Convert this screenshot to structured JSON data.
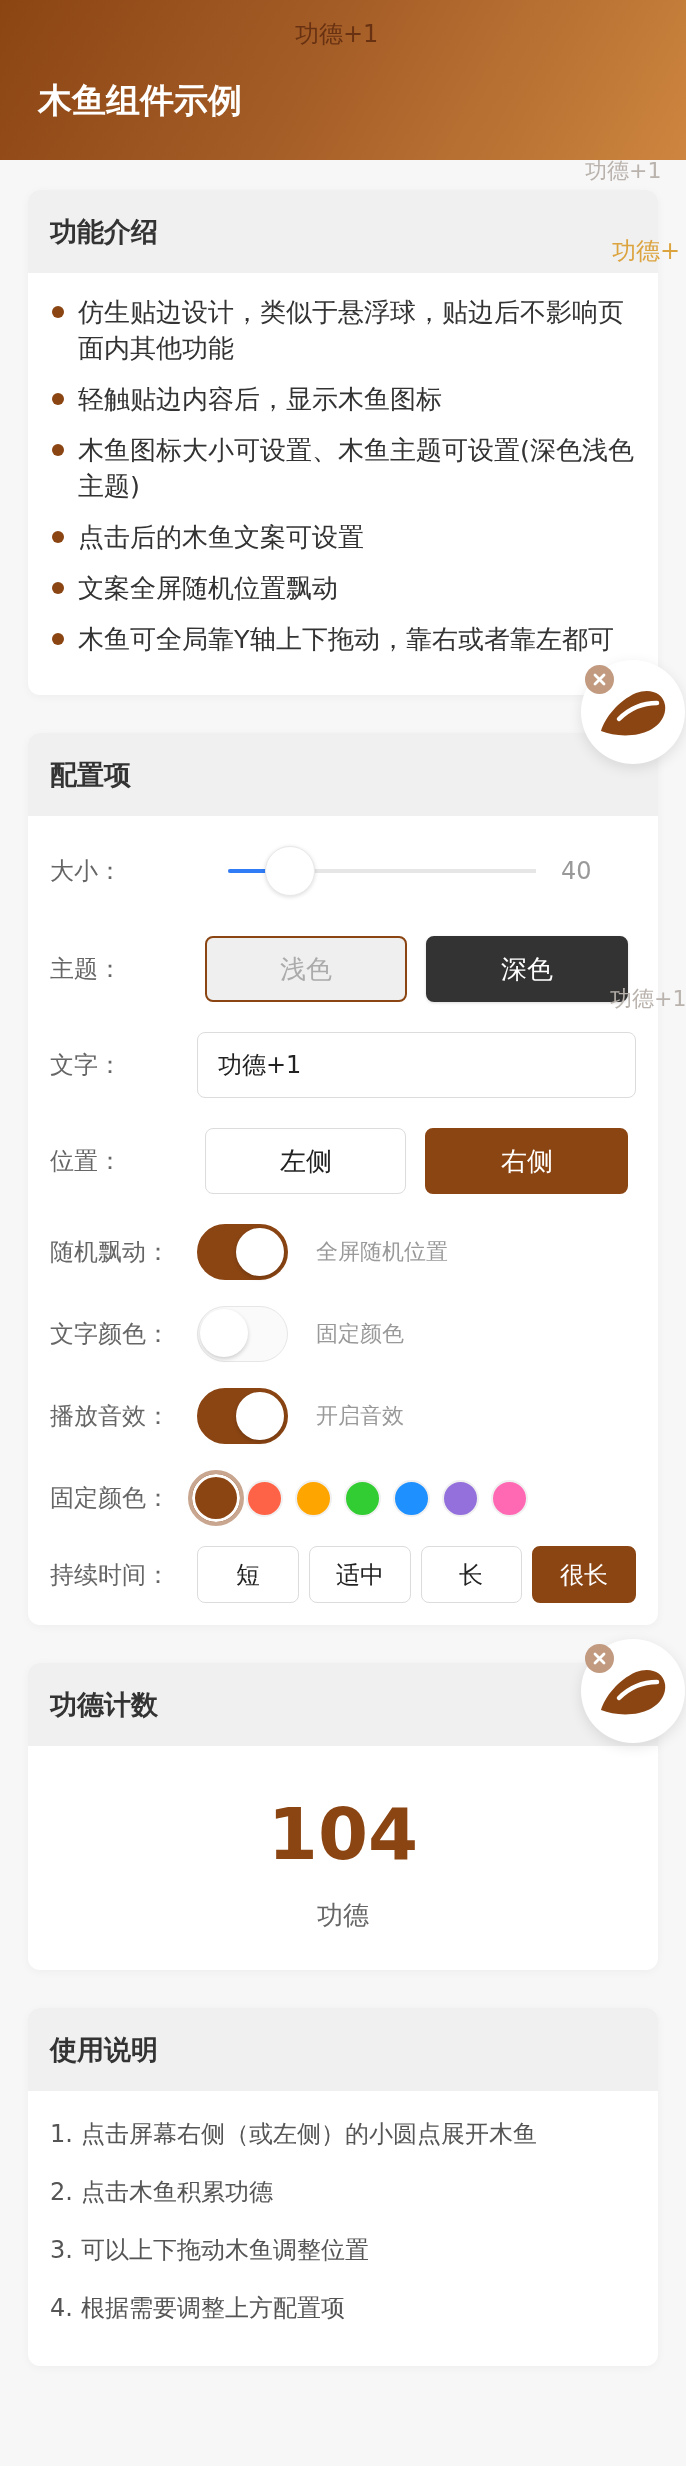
{
  "header": {
    "title": "木鱼组件示例"
  },
  "floating_texts": [
    {
      "text": "功德+1",
      "color": "#683212"
    },
    {
      "text": "功德+1",
      "color": "#bab3ad"
    },
    {
      "text": "功德+",
      "color": "#dca43f"
    },
    {
      "text": "功德+1",
      "color": "#bab3ad"
    }
  ],
  "sections": [
    {
      "kind": "bullets",
      "title": "功能介绍",
      "items": [
        "仿生贴边设计，类似于悬浮球，贴边后不影响页面内其他功能",
        "轻触贴边内容后，显示木鱼图标",
        "木鱼图标大小可设置、木鱼主题可设置(深色浅色主题)",
        "点击后的木鱼文案可设置",
        "文案全屏随机位置飘动",
        "木鱼可全局靠Y轴上下拖动，靠右或者靠左都可"
      ]
    },
    {
      "kind": "config",
      "title": "配置项",
      "rows": [
        {
          "kind": "slider",
          "label": "大小：",
          "level": 0.2,
          "reading": "40"
        },
        {
          "kind": "segmented",
          "label": "主题：",
          "options": [
            {
              "label": "浅色",
              "kind": "light",
              "selected": true
            },
            {
              "label": "深色",
              "kind": "dark",
              "selected": false
            }
          ]
        },
        {
          "kind": "text",
          "label": "文字：",
          "value": "功德+1"
        },
        {
          "kind": "segmented",
          "label": "位置：",
          "options": [
            {
              "label": "左侧",
              "selected": false
            },
            {
              "label": "右侧",
              "selected": true
            }
          ]
        },
        {
          "kind": "switch",
          "label": "随机飘动：",
          "on": true,
          "hint": "全屏随机位置"
        },
        {
          "kind": "switch",
          "label": "文字颜色：",
          "on": false,
          "hint": "固定颜色"
        },
        {
          "kind": "switch",
          "label": "播放音效：",
          "on": true,
          "hint": "开启音效"
        },
        {
          "kind": "colors",
          "label": "固定颜色：",
          "swatches": [
            {
              "color": "#8b4513",
              "selected": true
            },
            {
              "color": "#ff6347",
              "selected": false
            },
            {
              "color": "#ffa500",
              "selected": false
            },
            {
              "color": "#32cd32",
              "selected": false
            },
            {
              "color": "#1e90ff",
              "selected": false
            },
            {
              "color": "#9370db",
              "selected": false
            },
            {
              "color": "#ff69b4",
              "selected": false
            }
          ]
        },
        {
          "kind": "chips",
          "label": "持续时间：",
          "options": [
            {
              "label": "短",
              "selected": false
            },
            {
              "label": "适中",
              "selected": false
            },
            {
              "label": "长",
              "selected": false
            },
            {
              "label": "很长",
              "selected": true
            }
          ]
        }
      ]
    },
    {
      "kind": "counter",
      "title": "功德计数",
      "value": "104",
      "unit": "功德"
    },
    {
      "kind": "steps",
      "title": "使用说明",
      "items": [
        "1. 点击屏幕右侧（或左侧）的小圆点展开木鱼",
        "2. 点击木鱼积累功德",
        "3. 可以上下拖动木鱼调整位置",
        "4. 根据需要调整上方配置项"
      ]
    }
  ]
}
